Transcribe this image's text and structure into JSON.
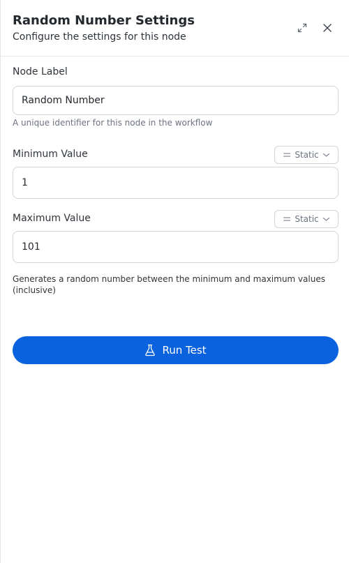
{
  "header": {
    "title": "Random Number Settings",
    "subtitle": "Configure the settings for this node",
    "expand_icon": "expand-icon",
    "close_icon": "close-icon"
  },
  "node_label": {
    "label": "Node Label",
    "value": "Random Number",
    "helper": "A unique identifier for this node in the workflow"
  },
  "minimum": {
    "label": "Minimum Value",
    "mode": "Static",
    "value": "1"
  },
  "maximum": {
    "label": "Maximum Value",
    "mode": "Static",
    "value": "101"
  },
  "description": "Generates a random number between the minimum and maximum values (inclusive)",
  "run_button": {
    "label": "Run Test",
    "icon": "flask-icon",
    "color": "#0a62de"
  }
}
